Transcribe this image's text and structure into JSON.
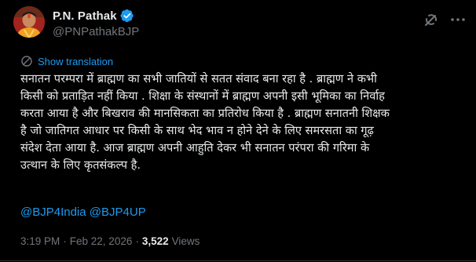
{
  "author": {
    "display_name": "P.N. Pathak",
    "handle": "@PNPathakBJP",
    "verified": true
  },
  "actions": {
    "grok_icon": "grok-icon",
    "more_icon": "more-dots-icon"
  },
  "translation": {
    "label": "Show translation"
  },
  "tweet": {
    "lines": [
      "सनातन परम्परा में ब्राह्मण का सभी जातियों से सतत संवाद बना रहा है .  ब्राह्मण ने कभी",
      "किसी को प्रताड़ित नहीं किया . शिक्षा के संस्थानों में ब्राह्मण अपनी इसी भूमिका का निर्वाह",
      "करता आया है और बिखराव की मानसिकता का प्रतिरोध किया है . ब्राह्मण सनातनी शिक्षक",
      "है जो जातिगत आधार पर किसी के साथ भेद भाव न होने देने के लिए समरसता का गूढ़",
      "संदेश देता आया है. आज ब्राह्मण अपनी आहुति देकर भी सनातन परंपरा की गरिमा के",
      "उत्थान के लिए कृतसंकल्प है."
    ],
    "mentions": [
      "@BJP4India",
      "@BJP4UP"
    ]
  },
  "meta": {
    "time": "3:19 PM",
    "separator": "·",
    "date": "Feb 22, 2026",
    "views_count": "3,522",
    "views_label": "Views"
  },
  "colors": {
    "background": "#000000",
    "text": "#e7e9ea",
    "secondary": "#71767b",
    "accent": "#1d9bf0",
    "border": "#2f3336"
  }
}
